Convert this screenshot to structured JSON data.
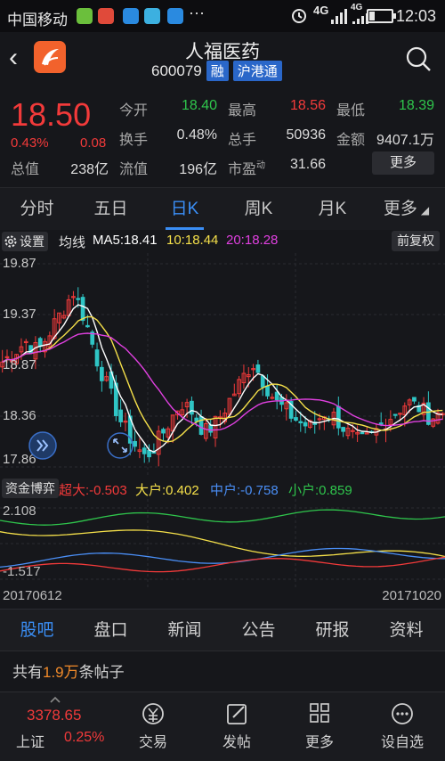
{
  "status_bar": {
    "carrier": "中国移动",
    "network": "4G",
    "network2": "4G",
    "time": "12:03",
    "dots": "···"
  },
  "header": {
    "name": "人福医药",
    "code": "600079",
    "tags": [
      "融",
      "沪港通"
    ]
  },
  "quote": {
    "price": "18.50",
    "change_pct": "0.43%",
    "change_abs": "0.08",
    "total_value_label": "总值",
    "total_value": "238亿",
    "open_label": "今开",
    "open": "18.40",
    "high_label": "最高",
    "high": "18.56",
    "low_label": "最低",
    "low": "18.39",
    "turnover_label": "换手",
    "turnover": "0.48%",
    "volume_label": "总手",
    "volume": "50936",
    "amount_label": "金额",
    "amount": "9407.1万",
    "float_label": "流值",
    "float": "196亿",
    "pe_label": "市盈",
    "pe_sup": "动",
    "pe": "31.66",
    "more_label": "更多"
  },
  "period_tabs": [
    "分时",
    "五日",
    "日K",
    "周K",
    "月K",
    "更多"
  ],
  "period_active": 2,
  "ma": {
    "settings_label": "设置",
    "title": "均线",
    "ma5": "MA5:18.41",
    "ma10": "10:18.44",
    "ma20": "20:18.28",
    "fq_label": "前复权"
  },
  "kchart_axis": [
    "19.87",
    "19.37",
    "18.87",
    "18.36",
    "17.86"
  ],
  "flow": {
    "btn_label": "资金博弈",
    "super": "超大:-0.503",
    "big": "大户:0.402",
    "mid": "中户:-0.758",
    "small": "小户:0.859"
  },
  "flow_axis": [
    "2.108",
    "-1.517"
  ],
  "dates": {
    "start": "20170612",
    "end": "20171020"
  },
  "section_tabs": [
    "股吧",
    "盘口",
    "新闻",
    "公告",
    "研报",
    "资料"
  ],
  "section_active": 0,
  "posts": {
    "prefix": "共有",
    "count": "1.9万",
    "suffix": "条帖子"
  },
  "bottom_bar": {
    "index_value": "3378.65",
    "index_name": "上证",
    "index_pct": "0.25%",
    "items": [
      "交易",
      "发帖",
      "更多",
      "设自选"
    ]
  },
  "colors": {
    "up": "#f23a3a",
    "down": "#2fc5c5",
    "accent": "#3a8ef5",
    "ma5": "#ffffff",
    "ma10": "#f5e04a",
    "ma20": "#e040e0"
  }
}
